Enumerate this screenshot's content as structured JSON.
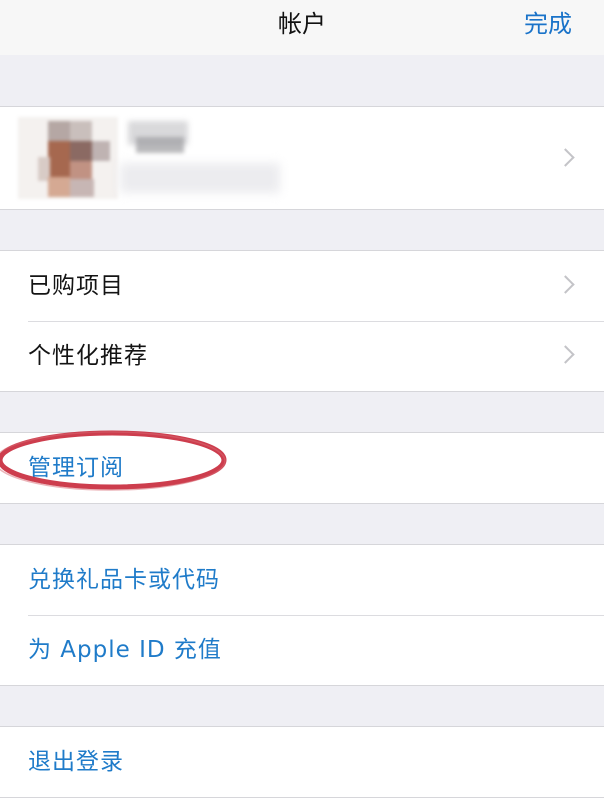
{
  "navbar": {
    "title": "帐户",
    "done_label": "完成"
  },
  "profile": {
    "avatar_icon": "avatar-icon",
    "name": "",
    "email": ""
  },
  "sections": [
    {
      "items": [
        {
          "label": "已购项目",
          "style": "default"
        },
        {
          "label": "个性化推荐",
          "style": "default"
        }
      ]
    },
    {
      "items": [
        {
          "label": "管理订阅",
          "style": "link",
          "highlighted": true
        }
      ]
    },
    {
      "items": [
        {
          "label": "兑换礼品卡或代码",
          "style": "link"
        },
        {
          "label": "为 Apple ID 充值",
          "style": "link"
        }
      ]
    },
    {
      "items": [
        {
          "label": "退出登录",
          "style": "link"
        }
      ]
    }
  ],
  "colors": {
    "link": "#1f7bc9",
    "background": "#efeff4",
    "highlight_annotation": "#c8283a"
  }
}
